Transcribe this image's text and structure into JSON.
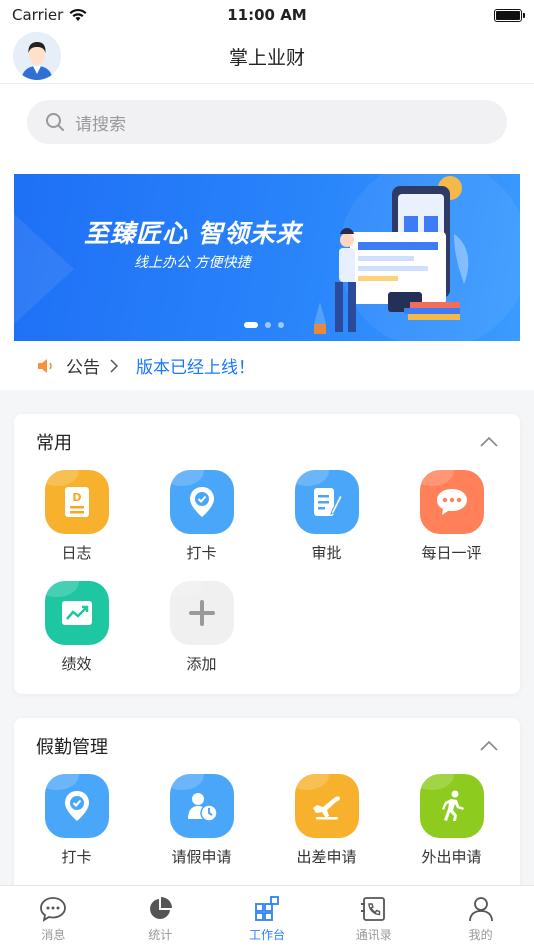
{
  "status": {
    "carrier": "Carrier",
    "time": "11:00 AM"
  },
  "nav": {
    "title": "掌上业财"
  },
  "search": {
    "placeholder": "请搜索"
  },
  "banner": {
    "title": "至臻匠心 智领未来",
    "subtitle": "线上办公 方便快捷"
  },
  "notice": {
    "label": "公告",
    "text": "版本已经上线！"
  },
  "common": {
    "title": "常用",
    "items": [
      {
        "label": "日志",
        "color": "#f7b12d",
        "icon": "document-d-icon"
      },
      {
        "label": "打卡",
        "color": "#4aa6f8",
        "icon": "location-check-icon"
      },
      {
        "label": "审批",
        "color": "#4aa6f8",
        "icon": "edit-doc-icon"
      },
      {
        "label": "每日一评",
        "color": "#ff8059",
        "icon": "chat-bubble-icon"
      },
      {
        "label": "绩效",
        "color": "#1ec6a2",
        "icon": "trend-chart-icon"
      },
      {
        "label": "添加",
        "color": "#f0f0f0",
        "icon": "plus-icon"
      }
    ]
  },
  "leave": {
    "title": "假勤管理",
    "items": [
      {
        "label": "打卡",
        "color": "#4aa6f8",
        "icon": "location-check-icon"
      },
      {
        "label": "请假申请",
        "color": "#4aa6f8",
        "icon": "person-clock-icon"
      },
      {
        "label": "出差申请",
        "color": "#f7b12d",
        "icon": "airplane-icon"
      },
      {
        "label": "外出申请",
        "color": "#8dcc1e",
        "icon": "walking-icon"
      }
    ]
  },
  "tabs": [
    {
      "label": "消息",
      "icon": "message-icon",
      "active": false
    },
    {
      "label": "统计",
      "icon": "pie-chart-icon",
      "active": false
    },
    {
      "label": "工作台",
      "icon": "workbench-icon",
      "active": true
    },
    {
      "label": "通讯录",
      "icon": "contacts-icon",
      "active": false
    },
    {
      "label": "我的",
      "icon": "profile-icon",
      "active": false
    }
  ]
}
